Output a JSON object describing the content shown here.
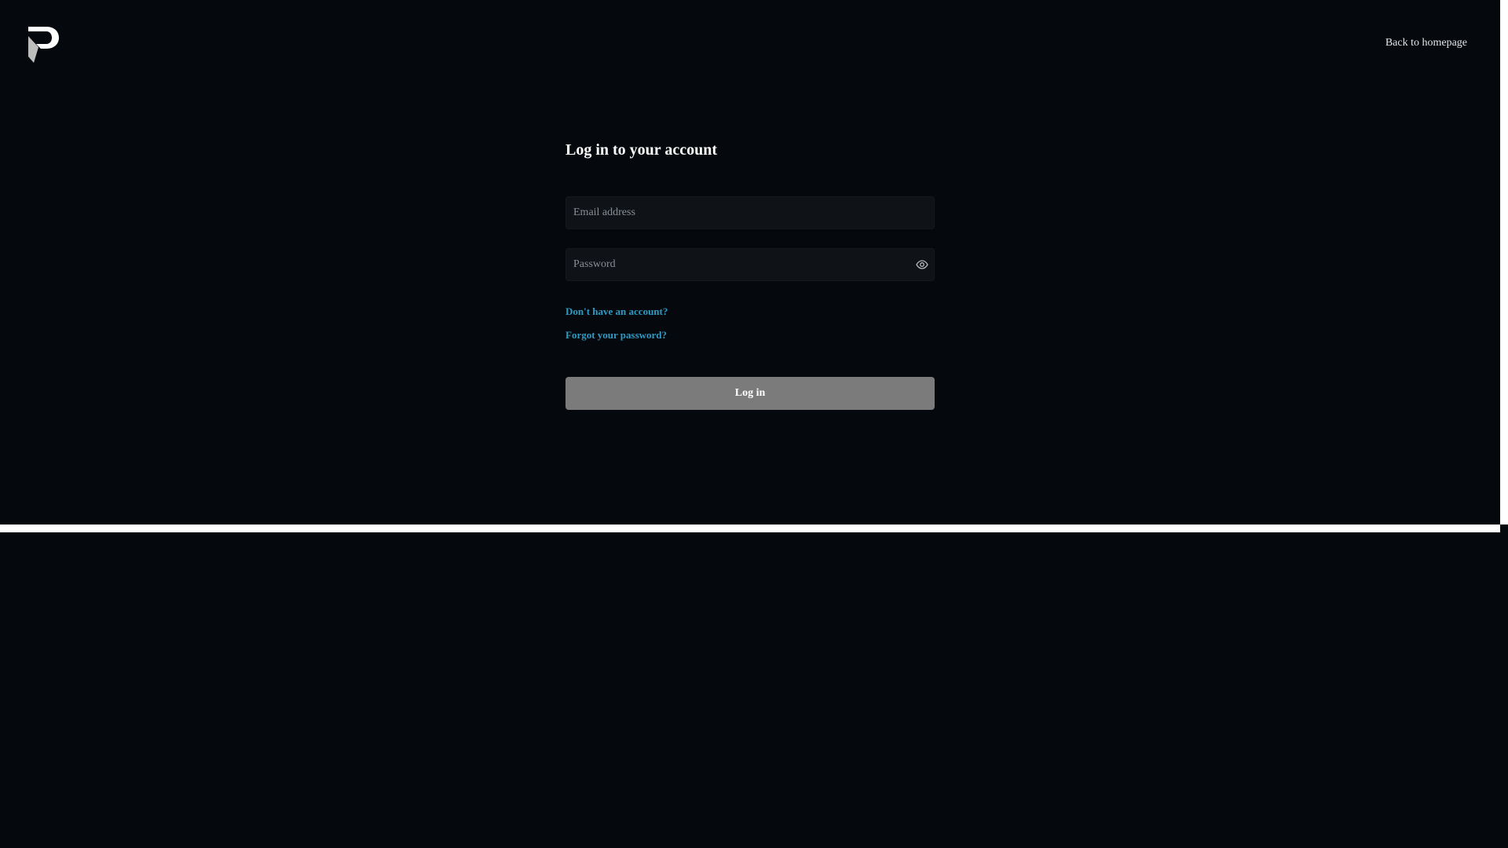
{
  "header": {
    "logo_icon": "brand-p-logo-icon",
    "back_link": "Back to homepage"
  },
  "login": {
    "title": "Log in to your account",
    "email": {
      "placeholder": "Email address",
      "value": ""
    },
    "password": {
      "placeholder": "Password",
      "value": "",
      "toggle_icon": "eye-icon"
    },
    "signup_link": "Don't have an account?",
    "forgot_link": "Forgot your password?",
    "submit_label": "Log in"
  },
  "colors": {
    "background": "#05080c",
    "input_background": "#0f1317",
    "link": "#2d9bc4",
    "button_disabled": "#7b7b7b",
    "text": "#ffffff"
  }
}
